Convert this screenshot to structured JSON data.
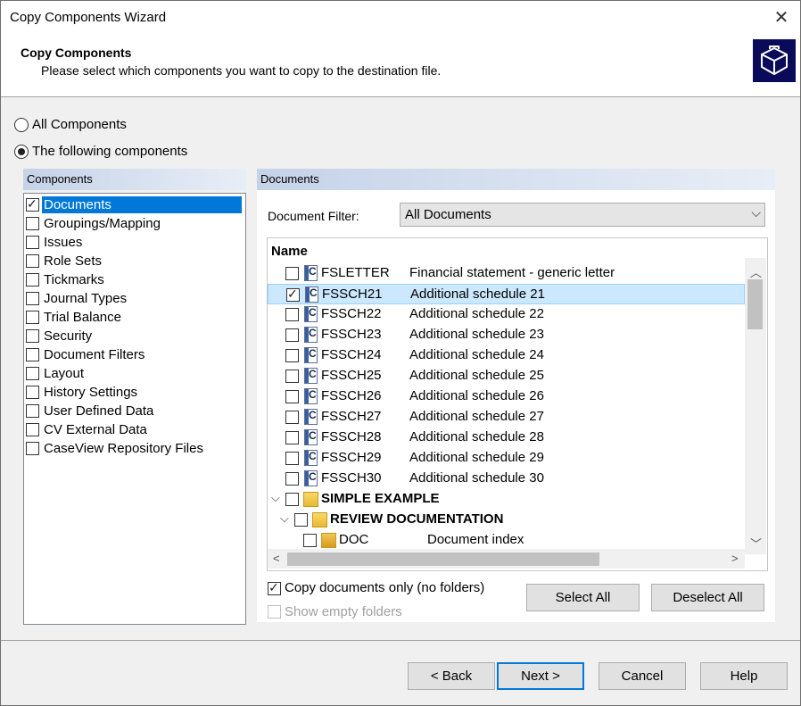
{
  "window": {
    "title": "Copy Components Wizard"
  },
  "header": {
    "title": "Copy Components",
    "subtitle": "Please select which components you want to copy to the destination file."
  },
  "options": {
    "all_components": "All Components",
    "following_components": "The following components",
    "selected": "following"
  },
  "components": {
    "header": "Components",
    "items": [
      {
        "label": "Documents",
        "checked": true,
        "selected": true
      },
      {
        "label": "Groupings/Mapping",
        "checked": false
      },
      {
        "label": "Issues",
        "checked": false
      },
      {
        "label": "Role Sets",
        "checked": false
      },
      {
        "label": "Tickmarks",
        "checked": false
      },
      {
        "label": "Journal Types",
        "checked": false
      },
      {
        "label": "Trial Balance",
        "checked": false
      },
      {
        "label": "Security",
        "checked": false
      },
      {
        "label": "Document Filters",
        "checked": false
      },
      {
        "label": "Layout",
        "checked": false
      },
      {
        "label": "History Settings",
        "checked": false
      },
      {
        "label": "User Defined Data",
        "checked": false
      },
      {
        "label": "CV External Data",
        "checked": false
      },
      {
        "label": "CaseView Repository Files",
        "checked": false
      }
    ]
  },
  "documents": {
    "header": "Documents",
    "filter_label": "Document Filter:",
    "filter_value": "All Documents",
    "column_name": "Name",
    "rows": [
      {
        "name": "FSLETTER",
        "desc": "Financial statement - generic letter",
        "checked": false
      },
      {
        "name": "FSSCH21",
        "desc": "Additional schedule 21",
        "checked": true,
        "selected": true
      },
      {
        "name": "FSSCH22",
        "desc": "Additional schedule 22",
        "checked": false
      },
      {
        "name": "FSSCH23",
        "desc": "Additional schedule 23",
        "checked": false
      },
      {
        "name": "FSSCH24",
        "desc": "Additional schedule 24",
        "checked": false
      },
      {
        "name": "FSSCH25",
        "desc": "Additional schedule 25",
        "checked": false
      },
      {
        "name": "FSSCH26",
        "desc": "Additional schedule 26",
        "checked": false
      },
      {
        "name": "FSSCH27",
        "desc": "Additional schedule 27",
        "checked": false
      },
      {
        "name": "FSSCH28",
        "desc": "Additional schedule 28",
        "checked": false
      },
      {
        "name": "FSSCH29",
        "desc": "Additional schedule 29",
        "checked": false
      },
      {
        "name": "FSSCH30",
        "desc": "Additional schedule 30",
        "checked": false
      }
    ],
    "folder1": "SIMPLE EXAMPLE",
    "folder2": "REVIEW DOCUMENTATION",
    "doc_index": {
      "name": "DOC",
      "desc": "Document index"
    },
    "icon_letter": "C",
    "copy_only_label": "Copy documents only (no folders)",
    "copy_only_checked": true,
    "show_empty_label": "Show empty folders",
    "select_all": "Select All",
    "deselect_all": "Deselect All"
  },
  "footer": {
    "back": "< Back",
    "next": "Next >",
    "cancel": "Cancel",
    "help": "Help"
  }
}
